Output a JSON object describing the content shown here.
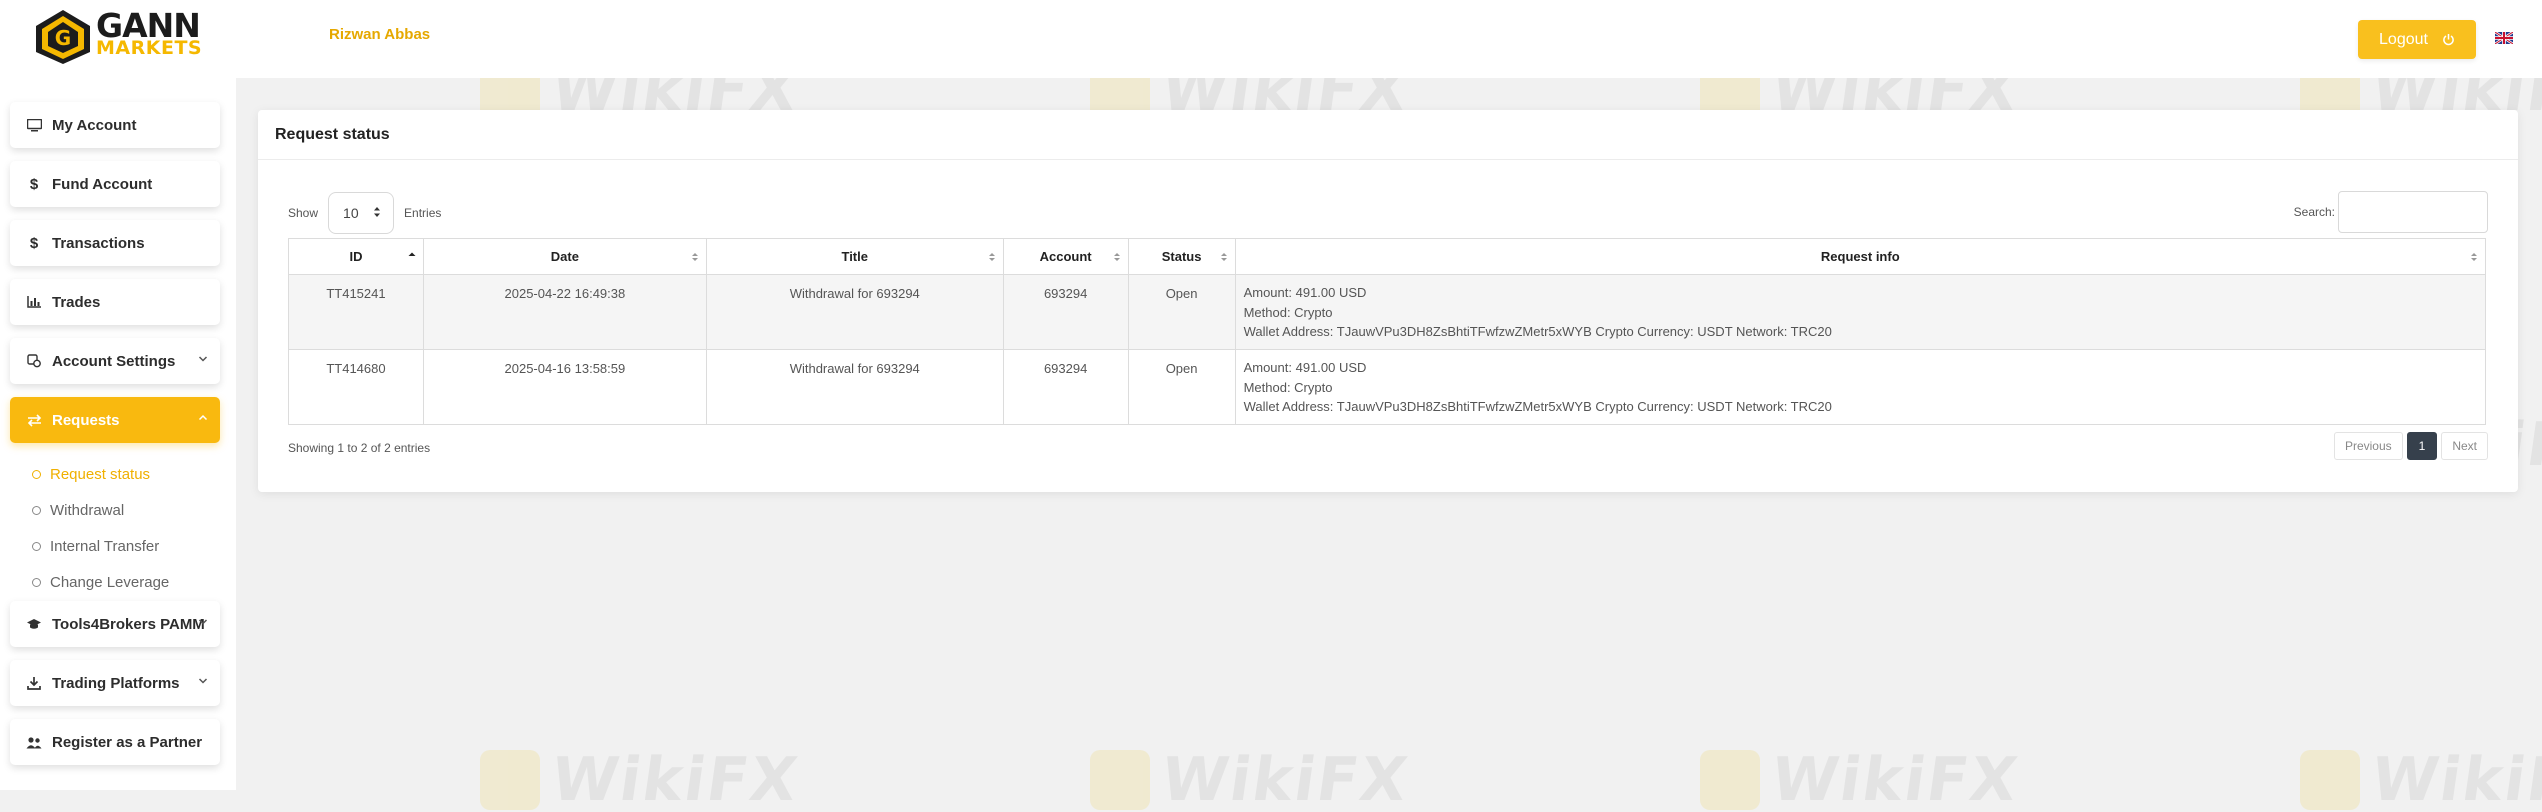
{
  "brand": {
    "line1": "GANN",
    "line2": "MARKETS",
    "colors": {
      "primary": "#f9b90f",
      "dark": "#1c1c1c"
    }
  },
  "user": {
    "name": "Rizwan Abbas"
  },
  "header": {
    "logout_label": "Logout",
    "language_icon": "uk-flag-icon"
  },
  "sidebar": {
    "items": [
      {
        "label": "My Account",
        "icon": "monitor-icon"
      },
      {
        "label": "Fund Account",
        "icon": "dollar-icon"
      },
      {
        "label": "Transactions",
        "icon": "dollar-icon"
      },
      {
        "label": "Trades",
        "icon": "bar-chart-icon"
      },
      {
        "label": "Account Settings",
        "icon": "settings-icon"
      },
      {
        "label": "Requests",
        "icon": "exchange-icon"
      },
      {
        "label": "Tools4Brokers PAMM",
        "icon": "graduation-cap-icon"
      },
      {
        "label": "Trading Platforms",
        "icon": "download-icon"
      },
      {
        "label": "Register as a Partner",
        "icon": "users-icon"
      }
    ],
    "requests_submenu": [
      {
        "label": "Request status"
      },
      {
        "label": "Withdrawal"
      },
      {
        "label": "Internal Transfer"
      },
      {
        "label": "Change Leverage"
      }
    ]
  },
  "card": {
    "title": "Request status",
    "show_label": "Show",
    "entries_value": "10",
    "entries_label": "Entries",
    "search_label": "Search:",
    "columns": [
      "ID",
      "Date",
      "Title",
      "Account",
      "Status",
      "Request info"
    ],
    "rows": [
      {
        "id": "TT415241",
        "date": "2025-04-22 16:49:38",
        "title": "Withdrawal for 693294",
        "account": "693294",
        "status": "Open",
        "info": [
          "Amount: 491.00 USD",
          "Method: Crypto",
          "Wallet Address: TJauwVPu3DH8ZsBhtiTFwfzwZMetr5xWYB Crypto Currency: USDT Network: TRC20"
        ]
      },
      {
        "id": "TT414680",
        "date": "2025-04-16 13:58:59",
        "title": "Withdrawal for 693294",
        "account": "693294",
        "status": "Open",
        "info": [
          "Amount: 491.00 USD",
          "Method: Crypto",
          "Wallet Address: TJauwVPu3DH8ZsBhtiTFwfzwZMetr5xWYB Crypto Currency: USDT Network: TRC20"
        ]
      }
    ],
    "showing_text": "Showing 1 to 2 of 2 entries",
    "pagination": {
      "previous": "Previous",
      "current": "1",
      "next": "Next"
    }
  },
  "watermark": {
    "text": "WikiFX"
  }
}
